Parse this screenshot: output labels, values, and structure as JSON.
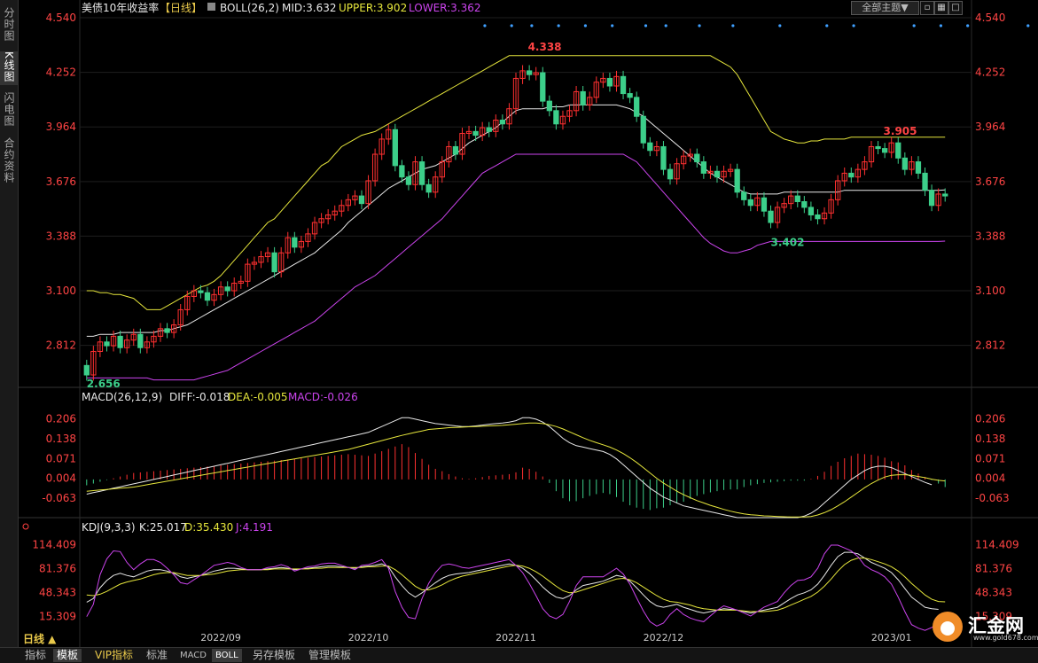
{
  "sidebar": {
    "items": [
      {
        "label": "分时图"
      },
      {
        "label": "K线图"
      },
      {
        "label": "闪电图"
      },
      {
        "label": "合约资料"
      }
    ]
  },
  "header": {
    "title": "美债10年收益率",
    "period": "【日线】",
    "boll_label": "BOLL(26,2)",
    "mid": "MID:3.632",
    "upper": "UPPER:3.902",
    "lower": "LOWER:3.362",
    "theme_select": "全部主题▼"
  },
  "macd_header": {
    "label": "MACD(26,12,9)",
    "diff": "DIFF:-0.018",
    "dea": "DEA:-0.005",
    "macd": "MACD:-0.026"
  },
  "kdj_header": {
    "label": "KDJ(9,3,3)",
    "k": "K:25.017",
    "d": "D:35.430",
    "j": "J:4.191"
  },
  "bottom": {
    "period_label": "日线 ▲",
    "tabs": [
      "指标",
      "模板",
      "VIP指标",
      "标准",
      "MACD",
      "BOLL",
      "另存模板",
      "管理模板"
    ]
  },
  "logo": {
    "name": "汇金网",
    "url": "www.gold678.com"
  },
  "colors": {
    "up": "#ff3030",
    "down": "#3ccf8a",
    "upper": "#e6e63c",
    "lower": "#cc44ee",
    "mid": "#e8e8e8",
    "dea": "#e6e63c"
  },
  "chart_data": [
    {
      "type": "candlestick",
      "title": "美债10年收益率",
      "y_ticks": [
        "4.540",
        "4.252",
        "3.964",
        "3.676",
        "3.388",
        "3.100",
        "2.812"
      ],
      "ylim": [
        2.6,
        4.54
      ],
      "x_ticks": [
        "2022/09",
        "2022/10",
        "2022/11",
        "2022/12",
        "2023/01"
      ],
      "annotations": {
        "max": "4.338",
        "min_start": "2.656",
        "local_min": "3.402",
        "local_max": "3.905"
      },
      "close": [
        2.656,
        2.78,
        2.83,
        2.81,
        2.86,
        2.8,
        2.84,
        2.87,
        2.8,
        2.83,
        2.86,
        2.9,
        2.88,
        2.92,
        3.0,
        3.07,
        3.1,
        3.09,
        3.05,
        3.08,
        3.12,
        3.1,
        3.14,
        3.15,
        3.24,
        3.25,
        3.28,
        3.3,
        3.2,
        3.3,
        3.38,
        3.33,
        3.36,
        3.4,
        3.46,
        3.48,
        3.5,
        3.52,
        3.55,
        3.58,
        3.6,
        3.56,
        3.68,
        3.82,
        3.9,
        3.95,
        3.76,
        3.7,
        3.66,
        3.78,
        3.66,
        3.62,
        3.7,
        3.78,
        3.86,
        3.82,
        3.93,
        3.94,
        3.92,
        3.96,
        3.94,
        4.0,
        3.98,
        4.06,
        4.22,
        4.26,
        4.24,
        4.25,
        4.1,
        4.05,
        3.98,
        4.02,
        4.05,
        4.15,
        4.08,
        4.12,
        4.2,
        4.22,
        4.18,
        4.23,
        4.14,
        4.12,
        4.02,
        3.88,
        3.84,
        3.86,
        3.74,
        3.69,
        3.77,
        3.81,
        3.82,
        3.78,
        3.72,
        3.73,
        3.7,
        3.73,
        3.74,
        3.62,
        3.58,
        3.55,
        3.59,
        3.52,
        3.46,
        3.54,
        3.56,
        3.6,
        3.57,
        3.54,
        3.5,
        3.48,
        3.51,
        3.58,
        3.68,
        3.72,
        3.7,
        3.74,
        3.78,
        3.86,
        3.85,
        3.83,
        3.88,
        3.8,
        3.74,
        3.78,
        3.72,
        3.63,
        3.55,
        3.61,
        3.6
      ],
      "upper": [
        3.1,
        3.1,
        3.09,
        3.09,
        3.08,
        3.08,
        3.07,
        3.06,
        3.03,
        3.0,
        3.0,
        3.0,
        3.02,
        3.04,
        3.06,
        3.08,
        3.1,
        3.12,
        3.13,
        3.15,
        3.18,
        3.22,
        3.26,
        3.3,
        3.34,
        3.38,
        3.42,
        3.46,
        3.48,
        3.52,
        3.56,
        3.6,
        3.64,
        3.68,
        3.72,
        3.76,
        3.78,
        3.82,
        3.86,
        3.88,
        3.9,
        3.92,
        3.93,
        3.94,
        3.96,
        3.98,
        4.0,
        4.02,
        4.04,
        4.06,
        4.08,
        4.1,
        4.12,
        4.14,
        4.16,
        4.18,
        4.2,
        4.22,
        4.24,
        4.26,
        4.28,
        4.3,
        4.32,
        4.34,
        4.34,
        4.34,
        4.34,
        4.34,
        4.34,
        4.34,
        4.34,
        4.34,
        4.34,
        4.34,
        4.34,
        4.34,
        4.34,
        4.34,
        4.34,
        4.34,
        4.34,
        4.34,
        4.34,
        4.34,
        4.34,
        4.34,
        4.34,
        4.34,
        4.34,
        4.34,
        4.34,
        4.34,
        4.34,
        4.34,
        4.32,
        4.3,
        4.28,
        4.24,
        4.18,
        4.12,
        4.06,
        4.0,
        3.94,
        3.92,
        3.9,
        3.89,
        3.88,
        3.88,
        3.89,
        3.89,
        3.9,
        3.9,
        3.9,
        3.9,
        3.91,
        3.91,
        3.91,
        3.91,
        3.91,
        3.91,
        3.91,
        3.91,
        3.91,
        3.91,
        3.91,
        3.91,
        3.91,
        3.91,
        3.91
      ],
      "mid": [
        2.86,
        2.86,
        2.87,
        2.87,
        2.87,
        2.88,
        2.88,
        2.88,
        2.88,
        2.88,
        2.88,
        2.89,
        2.89,
        2.9,
        2.91,
        2.92,
        2.94,
        2.96,
        2.98,
        3.0,
        3.02,
        3.04,
        3.06,
        3.08,
        3.1,
        3.12,
        3.14,
        3.16,
        3.18,
        3.2,
        3.22,
        3.24,
        3.26,
        3.28,
        3.3,
        3.33,
        3.36,
        3.39,
        3.42,
        3.46,
        3.49,
        3.52,
        3.55,
        3.58,
        3.61,
        3.64,
        3.66,
        3.68,
        3.7,
        3.72,
        3.74,
        3.75,
        3.76,
        3.78,
        3.8,
        3.82,
        3.85,
        3.88,
        3.9,
        3.92,
        3.94,
        3.96,
        3.99,
        4.02,
        4.05,
        4.06,
        4.06,
        4.06,
        4.06,
        4.07,
        4.07,
        4.07,
        4.08,
        4.08,
        4.08,
        4.08,
        4.08,
        4.08,
        4.08,
        4.08,
        4.07,
        4.06,
        4.04,
        4.02,
        3.99,
        3.96,
        3.93,
        3.9,
        3.87,
        3.84,
        3.81,
        3.78,
        3.75,
        3.72,
        3.7,
        3.68,
        3.66,
        3.64,
        3.62,
        3.61,
        3.61,
        3.61,
        3.61,
        3.61,
        3.62,
        3.62,
        3.62,
        3.62,
        3.62,
        3.62,
        3.62,
        3.62,
        3.62,
        3.63,
        3.63,
        3.63,
        3.63,
        3.63,
        3.63,
        3.63,
        3.63,
        3.63,
        3.63,
        3.63,
        3.63,
        3.63,
        3.63,
        3.63,
        3.632
      ],
      "lower": [
        2.64,
        2.64,
        2.64,
        2.64,
        2.64,
        2.64,
        2.64,
        2.64,
        2.64,
        2.64,
        2.63,
        2.63,
        2.63,
        2.63,
        2.63,
        2.63,
        2.63,
        2.64,
        2.65,
        2.66,
        2.67,
        2.68,
        2.7,
        2.72,
        2.74,
        2.76,
        2.78,
        2.8,
        2.82,
        2.84,
        2.86,
        2.88,
        2.9,
        2.92,
        2.94,
        2.97,
        3.0,
        3.03,
        3.06,
        3.09,
        3.12,
        3.14,
        3.16,
        3.18,
        3.21,
        3.24,
        3.27,
        3.3,
        3.33,
        3.36,
        3.39,
        3.42,
        3.45,
        3.48,
        3.52,
        3.56,
        3.6,
        3.64,
        3.68,
        3.72,
        3.74,
        3.76,
        3.78,
        3.8,
        3.82,
        3.82,
        3.82,
        3.82,
        3.82,
        3.82,
        3.82,
        3.82,
        3.82,
        3.82,
        3.82,
        3.82,
        3.82,
        3.82,
        3.82,
        3.82,
        3.82,
        3.8,
        3.78,
        3.74,
        3.7,
        3.66,
        3.62,
        3.58,
        3.54,
        3.5,
        3.46,
        3.42,
        3.38,
        3.35,
        3.33,
        3.31,
        3.3,
        3.3,
        3.31,
        3.32,
        3.34,
        3.35,
        3.36,
        3.36,
        3.36,
        3.36,
        3.36,
        3.36,
        3.36,
        3.36,
        3.36,
        3.36,
        3.36,
        3.36,
        3.36,
        3.36,
        3.36,
        3.36,
        3.36,
        3.36,
        3.36,
        3.36,
        3.36,
        3.36,
        3.36,
        3.36,
        3.36,
        3.36,
        3.362
      ]
    },
    {
      "type": "macd",
      "y_ticks": [
        "0.206",
        "0.138",
        "0.071",
        "0.004",
        "-0.063"
      ],
      "ylim": [
        -0.13,
        0.25
      ],
      "diff": [
        -0.05,
        -0.045,
        -0.04,
        -0.035,
        -0.03,
        -0.025,
        -0.02,
        -0.015,
        -0.01,
        -0.005,
        0.0,
        0.005,
        0.01,
        0.015,
        0.02,
        0.025,
        0.03,
        0.035,
        0.04,
        0.045,
        0.05,
        0.055,
        0.06,
        0.065,
        0.07,
        0.075,
        0.08,
        0.085,
        0.09,
        0.095,
        0.1,
        0.105,
        0.11,
        0.115,
        0.12,
        0.125,
        0.13,
        0.135,
        0.14,
        0.145,
        0.15,
        0.155,
        0.16,
        0.17,
        0.18,
        0.19,
        0.2,
        0.21,
        0.21,
        0.205,
        0.2,
        0.195,
        0.19,
        0.188,
        0.185,
        0.182,
        0.18,
        0.18,
        0.182,
        0.185,
        0.188,
        0.19,
        0.192,
        0.195,
        0.2,
        0.21,
        0.21,
        0.205,
        0.195,
        0.18,
        0.16,
        0.14,
        0.125,
        0.115,
        0.11,
        0.105,
        0.1,
        0.095,
        0.085,
        0.07,
        0.05,
        0.03,
        0.01,
        -0.01,
        -0.03,
        -0.045,
        -0.06,
        -0.07,
        -0.08,
        -0.09,
        -0.095,
        -0.1,
        -0.105,
        -0.11,
        -0.115,
        -0.12,
        -0.125,
        -0.13,
        -0.13,
        -0.13,
        -0.13,
        -0.13,
        -0.13,
        -0.13,
        -0.13,
        -0.13,
        -0.13,
        -0.125,
        -0.115,
        -0.1,
        -0.08,
        -0.06,
        -0.04,
        -0.02,
        0.0,
        0.015,
        0.03,
        0.04,
        0.045,
        0.045,
        0.04,
        0.03,
        0.02,
        0.01,
        0.0,
        -0.01,
        -0.018
      ],
      "dea": [
        -0.04,
        -0.038,
        -0.036,
        -0.034,
        -0.032,
        -0.03,
        -0.028,
        -0.026,
        -0.022,
        -0.018,
        -0.014,
        -0.01,
        -0.006,
        -0.002,
        0.002,
        0.006,
        0.01,
        0.014,
        0.018,
        0.022,
        0.026,
        0.03,
        0.034,
        0.038,
        0.042,
        0.046,
        0.05,
        0.054,
        0.058,
        0.062,
        0.066,
        0.07,
        0.074,
        0.078,
        0.082,
        0.086,
        0.09,
        0.094,
        0.098,
        0.102,
        0.108,
        0.114,
        0.12,
        0.126,
        0.132,
        0.138,
        0.144,
        0.15,
        0.155,
        0.16,
        0.165,
        0.17,
        0.172,
        0.174,
        0.176,
        0.177,
        0.178,
        0.179,
        0.18,
        0.181,
        0.182,
        0.183,
        0.184,
        0.186,
        0.188,
        0.19,
        0.192,
        0.192,
        0.19,
        0.186,
        0.18,
        0.172,
        0.162,
        0.152,
        0.142,
        0.133,
        0.125,
        0.118,
        0.11,
        0.1,
        0.088,
        0.074,
        0.058,
        0.04,
        0.022,
        0.004,
        -0.012,
        -0.026,
        -0.04,
        -0.052,
        -0.062,
        -0.072,
        -0.08,
        -0.088,
        -0.095,
        -0.102,
        -0.108,
        -0.113,
        -0.117,
        -0.12,
        -0.122,
        -0.124,
        -0.125,
        -0.126,
        -0.127,
        -0.128,
        -0.128,
        -0.128,
        -0.126,
        -0.121,
        -0.113,
        -0.103,
        -0.09,
        -0.076,
        -0.06,
        -0.044,
        -0.028,
        -0.014,
        -0.002,
        0.008,
        0.014,
        0.016,
        0.016,
        0.014,
        0.01,
        0.006,
        0.001,
        -0.003,
        -0.005
      ],
      "bars": [
        -0.02,
        -0.014,
        -0.008,
        -0.002,
        0.004,
        0.01,
        0.016,
        0.022,
        0.024,
        0.026,
        0.028,
        0.03,
        0.032,
        0.034,
        0.036,
        0.038,
        0.04,
        0.042,
        0.044,
        0.046,
        0.048,
        0.05,
        0.052,
        0.054,
        0.056,
        0.058,
        0.06,
        0.062,
        0.064,
        0.066,
        0.068,
        0.07,
        0.072,
        0.074,
        0.076,
        0.078,
        0.08,
        0.082,
        0.084,
        0.086,
        0.084,
        0.082,
        0.08,
        0.088,
        0.096,
        0.104,
        0.112,
        0.12,
        0.11,
        0.09,
        0.07,
        0.05,
        0.036,
        0.028,
        0.018,
        0.01,
        0.004,
        0.002,
        0.004,
        0.008,
        0.012,
        0.014,
        0.016,
        0.018,
        0.024,
        0.04,
        0.036,
        0.026,
        0.01,
        -0.012,
        -0.04,
        -0.064,
        -0.074,
        -0.074,
        -0.064,
        -0.056,
        -0.05,
        -0.046,
        -0.05,
        -0.06,
        -0.076,
        -0.088,
        -0.096,
        -0.1,
        -0.104,
        -0.098,
        -0.096,
        -0.088,
        -0.08,
        -0.076,
        -0.066,
        -0.056,
        -0.05,
        -0.044,
        -0.04,
        -0.036,
        -0.034,
        -0.034,
        -0.026,
        -0.02,
        -0.016,
        -0.012,
        -0.01,
        -0.008,
        -0.006,
        -0.004,
        -0.004,
        -0.004,
        0.002,
        0.012,
        0.026,
        0.046,
        0.06,
        0.072,
        0.08,
        0.088,
        0.086,
        0.084,
        0.08,
        0.074,
        0.062,
        0.058,
        0.048,
        0.032,
        0.02,
        0.008,
        -0.002,
        -0.014,
        -0.026
      ]
    },
    {
      "type": "kdj",
      "y_ticks": [
        "114.409",
        "81.376",
        "48.343",
        "15.309"
      ],
      "ylim": [
        -5,
        125
      ],
      "k": [
        35,
        40,
        55,
        65,
        72,
        75,
        72,
        70,
        74,
        78,
        80,
        80,
        78,
        75,
        70,
        68,
        70,
        72,
        75,
        78,
        80,
        82,
        82,
        81,
        80,
        80,
        80,
        81,
        82,
        83,
        82,
        80,
        81,
        82,
        83,
        84,
        85,
        85,
        84,
        83,
        82,
        84,
        85,
        86,
        88,
        84,
        70,
        58,
        48,
        42,
        48,
        55,
        62,
        68,
        72,
        74,
        75,
        76,
        78,
        80,
        82,
        84,
        86,
        88,
        86,
        82,
        75,
        66,
        56,
        48,
        42,
        40,
        44,
        52,
        58,
        60,
        62,
        64,
        68,
        72,
        70,
        64,
        55,
        45,
        36,
        30,
        28,
        30,
        32,
        28,
        25,
        22,
        20,
        22,
        24,
        26,
        25,
        24,
        22,
        20,
        22,
        24,
        26,
        28,
        34,
        40,
        45,
        48,
        52,
        60,
        72,
        86,
        98,
        104,
        104,
        102,
        96,
        90,
        86,
        82,
        76,
        66,
        54,
        42,
        35,
        28,
        26,
        25.017
      ],
      "d": [
        45,
        44,
        46,
        50,
        55,
        60,
        63,
        65,
        67,
        70,
        73,
        75,
        76,
        76,
        74,
        72,
        72,
        72,
        73,
        74,
        76,
        78,
        79,
        80,
        80,
        80,
        80,
        80,
        81,
        81,
        81,
        81,
        81,
        81,
        82,
        82,
        83,
        83,
        83,
        83,
        83,
        83,
        84,
        84,
        85,
        85,
        80,
        73,
        65,
        57,
        52,
        52,
        55,
        59,
        64,
        68,
        71,
        73,
        75,
        77,
        79,
        81,
        83,
        85,
        86,
        85,
        82,
        77,
        71,
        64,
        57,
        51,
        48,
        49,
        52,
        55,
        58,
        61,
        64,
        67,
        68,
        66,
        62,
        56,
        50,
        44,
        39,
        36,
        35,
        33,
        31,
        28,
        26,
        25,
        24,
        24,
        24,
        24,
        23,
        22,
        22,
        22,
        23,
        24,
        27,
        31,
        35,
        39,
        43,
        49,
        57,
        67,
        78,
        87,
        93,
        96,
        96,
        94,
        91,
        88,
        84,
        78,
        70,
        61,
        53,
        45,
        39,
        36,
        35.43
      ],
      "j": [
        15,
        32,
        73,
        95,
        106,
        105,
        90,
        80,
        88,
        94,
        94,
        90,
        82,
        73,
        62,
        60,
        66,
        72,
        79,
        86,
        88,
        90,
        88,
        83,
        80,
        80,
        80,
        83,
        84,
        87,
        84,
        78,
        81,
        84,
        85,
        88,
        89,
        89,
        86,
        83,
        80,
        86,
        87,
        90,
        94,
        82,
        50,
        28,
        14,
        12,
        40,
        61,
        76,
        86,
        88,
        86,
        83,
        82,
        84,
        86,
        88,
        90,
        92,
        94,
        86,
        76,
        61,
        44,
        26,
        16,
        12,
        18,
        36,
        58,
        70,
        70,
        70,
        70,
        76,
        82,
        74,
        60,
        41,
        23,
        8,
        2,
        6,
        18,
        26,
        18,
        13,
        10,
        8,
        16,
        24,
        30,
        27,
        24,
        20,
        16,
        22,
        28,
        32,
        36,
        48,
        58,
        65,
        66,
        70,
        82,
        102,
        114,
        114,
        110,
        106,
        98,
        86,
        80,
        76,
        70,
        60,
        42,
        22,
        4,
        -1,
        -4,
        0,
        4.191
      ]
    }
  ]
}
